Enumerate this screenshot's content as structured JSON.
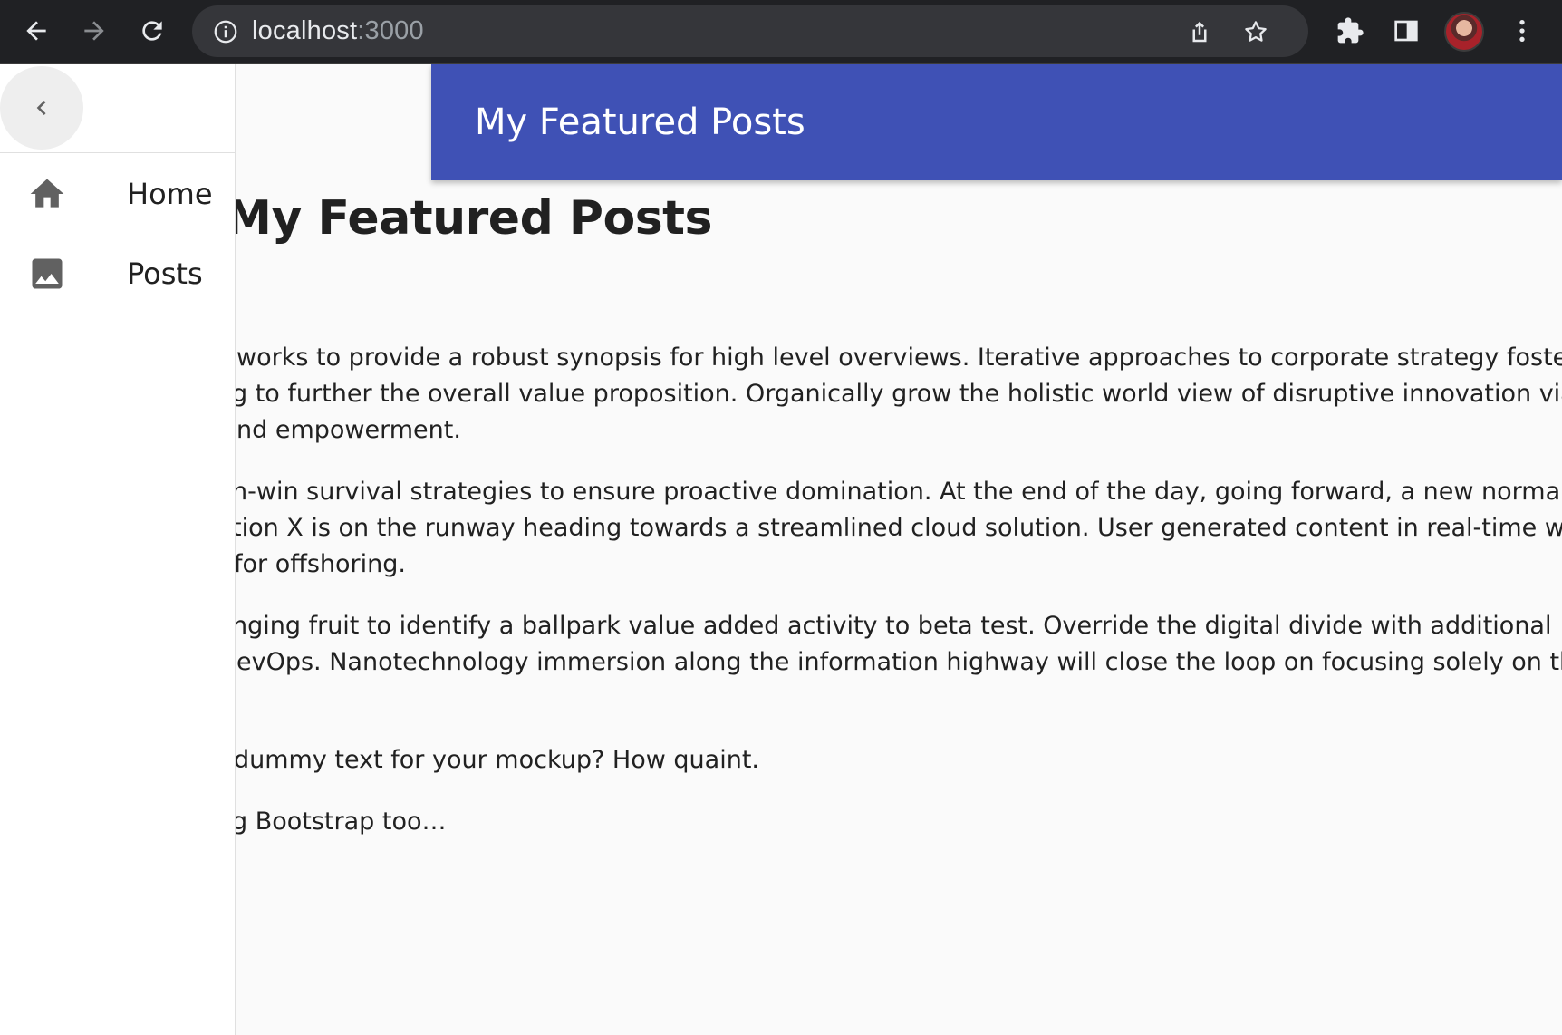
{
  "browser": {
    "url_host": "localhost",
    "url_port": ":3000",
    "icons": [
      "back-icon",
      "forward-icon",
      "reload-icon",
      "site-info-icon",
      "share-icon",
      "bookmark-star-icon",
      "extensions-icon",
      "side-panel-icon",
      "profile-avatar",
      "more-menu-icon"
    ]
  },
  "appbar": {
    "title": "My Featured Posts",
    "color": "#3f51b5"
  },
  "drawer": {
    "items": [
      {
        "label": "Home",
        "icon": "home-icon"
      },
      {
        "label": "Posts",
        "icon": "image-icon"
      }
    ]
  },
  "main": {
    "heading": "to My Featured Posts",
    "paragraphs": [
      [
        "works to provide a robust synopsis for high level overviews. Iterative approaches to corporate strategy foster",
        "g to further the overall value proposition. Organically grow the holistic world view of disruptive innovation via",
        "nd empowerment."
      ],
      [
        "n-win survival strategies to ensure proactive domination. At the end of the day, going forward, a new normal that has",
        "tion X is on the runway heading towards a streamlined cloud solution. User generated content in real-time will have",
        " for offshoring."
      ],
      [
        "nging fruit to identify a ballpark value added activity to beta test. Override the digital divide with additional",
        "evOps. Nanotechnology immersion along the information highway will close the loop on focusing solely on the"
      ],
      [
        "dummy text for your mockup? How quaint."
      ],
      [
        "g Bootstrap too…"
      ]
    ]
  }
}
